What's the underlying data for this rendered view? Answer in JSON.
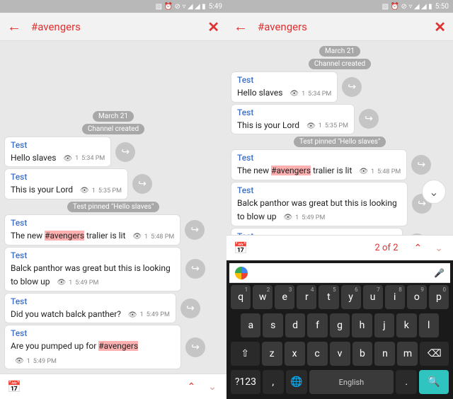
{
  "status_left": {
    "time": "5:49",
    "icons": "▧ ⏰ ⊘ ▿ ◢ ◢ ▮"
  },
  "status_right": {
    "time": "5:50",
    "icons": "▧ ⏰ ⊘ ▿ ◢ ◢ ▮"
  },
  "header": {
    "title": "#avengers"
  },
  "pills": {
    "date": "March 21",
    "created": "Channel created",
    "pinned": "Test pinned \"Hello slaves\""
  },
  "messages": [
    {
      "sender": "Test",
      "text": "Hello slaves",
      "views": "1",
      "time": "5:34 PM",
      "highlight": null
    },
    {
      "sender": "Test",
      "text": "This is your Lord",
      "views": "1",
      "time": "5:35 PM",
      "highlight": null
    },
    {
      "sender": "Test",
      "text_pre": "The new ",
      "highlight": "#avengers",
      "text_post": " tralier is lit",
      "views": "1",
      "time": "5:48 PM"
    },
    {
      "sender": "Test",
      "text": "Balck panthor was great but this is looking to blow up",
      "views": "1",
      "time": "5:49 PM",
      "highlight": null
    },
    {
      "sender": "Test",
      "text": "Did you watch balck panther?",
      "views": "1",
      "time": "5:49 PM",
      "highlight": null
    },
    {
      "sender": "Test",
      "text_pre": "Are you pumped up for ",
      "highlight": "#avengers",
      "text_post": "",
      "views": "1",
      "time": "5:49 PM"
    }
  ],
  "nav": {
    "count": "2 of 2"
  },
  "keyboard": {
    "row1": [
      "q",
      "w",
      "e",
      "r",
      "t",
      "y",
      "u",
      "i",
      "o",
      "p"
    ],
    "row1sup": [
      "1",
      "2",
      "3",
      "4",
      "5",
      "6",
      "7",
      "8",
      "9",
      "0"
    ],
    "row2": [
      "a",
      "s",
      "d",
      "f",
      "g",
      "h",
      "j",
      "k",
      "l"
    ],
    "row3": [
      "z",
      "x",
      "c",
      "v",
      "b",
      "n",
      "m"
    ],
    "shift": "⇧",
    "back": "⌫",
    "sym": "?123",
    "comma": ",",
    "globe": "🌐",
    "space": "English",
    "dot": ".",
    "search": "🔍"
  }
}
